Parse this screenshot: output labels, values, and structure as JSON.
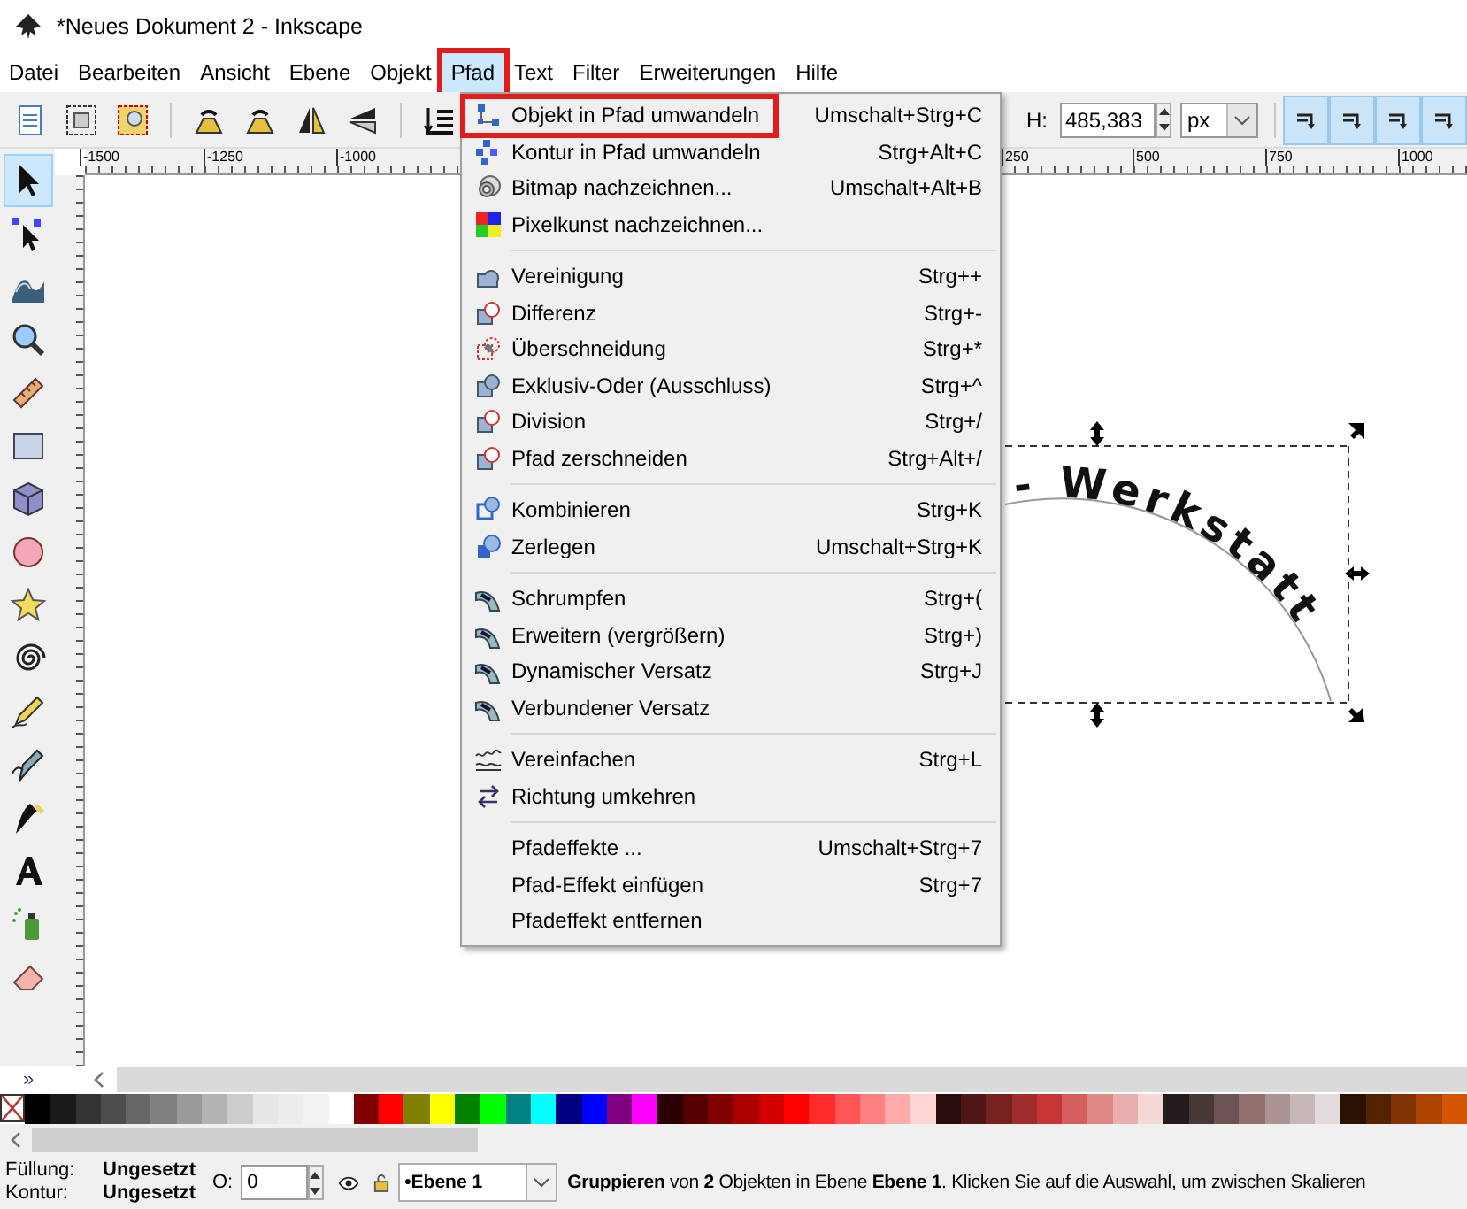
{
  "window": {
    "title": "*Neues Dokument 2 - Inkscape"
  },
  "menu_bar": [
    {
      "label": "Datei",
      "selected": false,
      "marked": false
    },
    {
      "label": "Bearbeiten",
      "selected": false,
      "marked": false
    },
    {
      "label": "Ansicht",
      "selected": false,
      "marked": false
    },
    {
      "label": "Ebene",
      "selected": false,
      "marked": false
    },
    {
      "label": "Objekt",
      "selected": false,
      "marked": false
    },
    {
      "label": "Pfad",
      "selected": true,
      "marked": true
    },
    {
      "label": "Text",
      "selected": false,
      "marked": false
    },
    {
      "label": "Filter",
      "selected": false,
      "marked": false
    },
    {
      "label": "Erweiterungen",
      "selected": false,
      "marked": false
    },
    {
      "label": "Hilfe",
      "selected": false,
      "marked": false
    }
  ],
  "toolbar": {
    "height_label": "H:",
    "height_value": "485,383",
    "unit": "px",
    "snap_buttons": [
      {
        "on": true
      },
      {
        "on": true
      },
      {
        "on": true
      },
      {
        "on": true
      }
    ]
  },
  "ruler": {
    "labels": [
      "-1500",
      "-1250",
      "-1000",
      "250",
      "500",
      "750",
      "1000"
    ]
  },
  "tools": [
    {
      "kind": "select",
      "selected": true
    },
    {
      "kind": "node",
      "selected": false
    },
    {
      "kind": "tweak",
      "selected": false
    },
    {
      "kind": "zoom",
      "selected": false
    },
    {
      "kind": "measure",
      "selected": false
    },
    {
      "kind": "rect",
      "selected": false
    },
    {
      "kind": "box3d",
      "selected": false
    },
    {
      "kind": "ellipse",
      "selected": false
    },
    {
      "kind": "star",
      "selected": false
    },
    {
      "kind": "spiral",
      "selected": false
    },
    {
      "kind": "pencil",
      "selected": false
    },
    {
      "kind": "pen",
      "selected": false
    },
    {
      "kind": "calligraphy",
      "selected": false
    },
    {
      "kind": "text",
      "selected": false
    },
    {
      "kind": "spray",
      "selected": false
    },
    {
      "kind": "eraser",
      "selected": false
    }
  ],
  "toolbox_overflow": "»",
  "canvas": {
    "curved_text": "- Werkstatt"
  },
  "path_menu": {
    "groups": [
      [
        {
          "label": "Objekt in Pfad umwandeln",
          "shortcut": "Umschalt+Strg+C",
          "kind": "object-to-path",
          "marked": true
        },
        {
          "label": "Kontur in Pfad umwandeln",
          "shortcut": "Strg+Alt+C",
          "kind": "stroke-to-path",
          "marked": false
        },
        {
          "label": "Bitmap nachzeichnen...",
          "shortcut": "Umschalt+Alt+B",
          "kind": "trace-bitmap",
          "marked": false
        },
        {
          "label": "Pixelkunst nachzeichnen...",
          "kind": "trace-pixel",
          "marked": false
        }
      ],
      [
        {
          "label": "Vereinigung",
          "shortcut": "Strg++",
          "kind": "union",
          "marked": false
        },
        {
          "label": "Differenz",
          "shortcut": "Strg+-",
          "kind": "difference",
          "marked": false
        },
        {
          "label": "Überschneidung",
          "shortcut": "Strg+*",
          "kind": "intersection",
          "marked": false
        },
        {
          "label": "Exklusiv-Oder (Ausschluss)",
          "shortcut": "Strg+^",
          "kind": "exclusion",
          "marked": false
        },
        {
          "label": "Division",
          "shortcut": "Strg+/",
          "kind": "division",
          "marked": false
        },
        {
          "label": "Pfad zerschneiden",
          "shortcut": "Strg+Alt+/",
          "kind": "cut",
          "marked": false
        }
      ],
      [
        {
          "label": "Kombinieren",
          "shortcut": "Strg+K",
          "kind": "combine",
          "marked": false
        },
        {
          "label": "Zerlegen",
          "shortcut": "Umschalt+Strg+K",
          "kind": "break-apart",
          "marked": false
        }
      ],
      [
        {
          "label": "Schrumpfen",
          "shortcut": "Strg+(",
          "kind": "inset",
          "marked": false
        },
        {
          "label": "Erweitern (vergrößern)",
          "shortcut": "Strg+)",
          "kind": "outset",
          "marked": false
        },
        {
          "label": "Dynamischer Versatz",
          "shortcut": "Strg+J",
          "kind": "dynamic-offset",
          "marked": false
        },
        {
          "label": "Verbundener Versatz",
          "kind": "linked-offset",
          "marked": false
        }
      ],
      [
        {
          "label": "Vereinfachen",
          "shortcut": "Strg+L",
          "kind": "simplify",
          "marked": false
        },
        {
          "label": "Richtung umkehren",
          "kind": "reverse",
          "marked": false
        }
      ],
      [
        {
          "label": "Pfadeffekte ...",
          "shortcut": "Umschalt+Strg+7",
          "kind": "plain",
          "marked": false
        },
        {
          "label": "Pfad-Effekt einfügen",
          "shortcut": "Strg+7",
          "kind": "plain",
          "marked": false
        },
        {
          "label": "Pfadeffekt entfernen",
          "kind": "plain",
          "marked": false
        }
      ]
    ]
  },
  "palette": [
    {
      "color": "#000000"
    },
    {
      "color": "#1a1a1a"
    },
    {
      "color": "#333333"
    },
    {
      "color": "#4d4d4d"
    },
    {
      "color": "#666666"
    },
    {
      "color": "#808080"
    },
    {
      "color": "#999999"
    },
    {
      "color": "#b3b3b3"
    },
    {
      "color": "#cccccc"
    },
    {
      "color": "#e6e6e6"
    },
    {
      "color": "#ececec"
    },
    {
      "color": "#f2f2f2"
    },
    {
      "color": "#ffffff"
    },
    {
      "color": "#800000"
    },
    {
      "color": "#ff0000"
    },
    {
      "color": "#808000"
    },
    {
      "color": "#ffff00"
    },
    {
      "color": "#008000"
    },
    {
      "color": "#00ff00"
    },
    {
      "color": "#008080"
    },
    {
      "color": "#00ffff"
    },
    {
      "color": "#000080"
    },
    {
      "color": "#0000ff"
    },
    {
      "color": "#800080"
    },
    {
      "color": "#ff00ff"
    },
    {
      "color": "#2b0000"
    },
    {
      "color": "#550000"
    },
    {
      "color": "#800000"
    },
    {
      "color": "#aa0000"
    },
    {
      "color": "#d40000"
    },
    {
      "color": "#ff0000"
    },
    {
      "color": "#ff2a2a"
    },
    {
      "color": "#ff5555"
    },
    {
      "color": "#ff8080"
    },
    {
      "color": "#ffaaaa"
    },
    {
      "color": "#ffd5d5"
    },
    {
      "color": "#280b0b"
    },
    {
      "color": "#501616"
    },
    {
      "color": "#782121"
    },
    {
      "color": "#a02c2c"
    },
    {
      "color": "#c83737"
    },
    {
      "color": "#d35f5f"
    },
    {
      "color": "#de8787"
    },
    {
      "color": "#e9afaf"
    },
    {
      "color": "#f4d7d7"
    },
    {
      "color": "#241c1c"
    },
    {
      "color": "#483737"
    },
    {
      "color": "#6c5353"
    },
    {
      "color": "#916f6f"
    },
    {
      "color": "#ac9393"
    },
    {
      "color": "#c8b7b7"
    },
    {
      "color": "#e3dbdb"
    },
    {
      "color": "#2b1100"
    },
    {
      "color": "#552200"
    },
    {
      "color": "#803300"
    },
    {
      "color": "#aa4400"
    },
    {
      "color": "#d45500"
    }
  ],
  "status_bar": {
    "fill_label": "Füllung:",
    "fill_value": "Ungesetzt",
    "stroke_label": "Kontur:",
    "stroke_value": "Ungesetzt",
    "opacity_label": "O:",
    "opacity_value": "0",
    "layer": "•Ebene 1",
    "message": "**Gruppieren** von **2** Objekten in Ebene **Ebene 1**. Klicken Sie auf die Auswahl, um zwischen Skalieren"
  }
}
